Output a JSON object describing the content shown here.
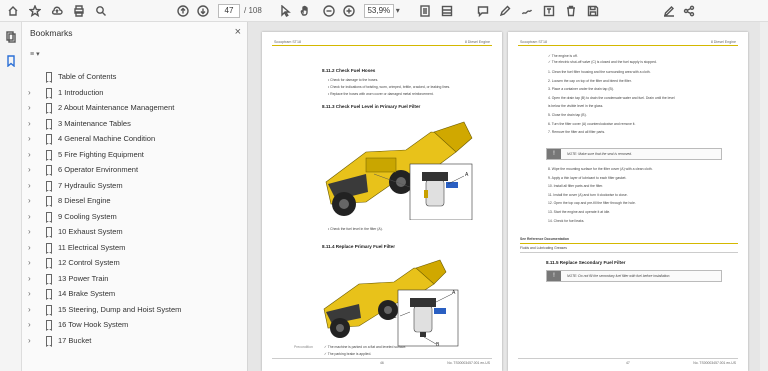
{
  "toolbar": {
    "current_page": "47",
    "page_total": "/ 108",
    "zoom": "53,9%"
  },
  "panel": {
    "title": "Bookmarks",
    "close": "×",
    "options_icon": "≡",
    "options_chevron": "▾"
  },
  "bookmarks": [
    {
      "label": "Table of Contents",
      "expandable": false
    },
    {
      "label": "1 Introduction",
      "expandable": true
    },
    {
      "label": "2 About Maintenance Management",
      "expandable": true
    },
    {
      "label": "3 Maintenance Tables",
      "expandable": true
    },
    {
      "label": "4 General Machine Condition",
      "expandable": true
    },
    {
      "label": "5 Fire Fighting Equipment",
      "expandable": true
    },
    {
      "label": "6 Operator Environment",
      "expandable": true
    },
    {
      "label": "7 Hydraulic System",
      "expandable": true
    },
    {
      "label": "8 Diesel Engine",
      "expandable": true
    },
    {
      "label": "9 Cooling System",
      "expandable": true
    },
    {
      "label": "10 Exhaust System",
      "expandable": true
    },
    {
      "label": "11 Electrical System",
      "expandable": true
    },
    {
      "label": "12 Control System",
      "expandable": true
    },
    {
      "label": "13 Power Train",
      "expandable": true
    },
    {
      "label": "14 Brake System",
      "expandable": true
    },
    {
      "label": "15 Steering, Dump and Hoist System",
      "expandable": true
    },
    {
      "label": "16 Tow Hook System",
      "expandable": true
    },
    {
      "label": "17 Bucket",
      "expandable": true
    }
  ],
  "page_left": {
    "header_left": "Scooptram ST18",
    "header_right": "8 Diesel Engine",
    "h1": "8.11.2 Check Fuel Hoses",
    "bullets1": [
      "Check for damage to the hoses.",
      "Check for indications of twisting, worn, crimped, brittle, cracked, or leaking lines.",
      "Replace the hoses with worn cover or damaged metal reinforcement."
    ],
    "h2": "8.11.3 Check Fuel Level in Primary Fuel Filter",
    "callout_a": "A",
    "caption1": "Check the fuel level in the filter (A).",
    "h3": "8.11.4 Replace Primary Fuel Filter",
    "callout_a2": "A",
    "callout_b2": "B",
    "callout_c2": "C",
    "precond_label": "Precondition",
    "precond1": "The machine is parked on a flat and leveled surface.",
    "precond2": "The parking brake is applied.",
    "footer_left": "46",
    "footer_right": "No. TS00003457.001 en-US"
  },
  "page_right": {
    "header_left": "Scooptram ST18",
    "header_right": "8 Diesel Engine",
    "checks": [
      "The engine is off.",
      "The electric shut-off valve (C) is closed and the fuel supply is stopped."
    ],
    "steps": [
      "1.  Clean the fuel filter housing and the surrounding area with a cloth.",
      "2.  Loosen the cap on top of the filter and bleed the filter.",
      "3.  Place a container under the drain tap (B).",
      "4.  Open the drain tap (B) to drain the condensate water and fuel. Drain until the level",
      "     is below the visible level in the glass.",
      "5.  Close the drain tap (B).",
      "6.  Turn the filter cover (A) counterclockwise and remove it.",
      "7.  Remove the filter and all filter parts."
    ],
    "note1": "NOTE: Make sure that the seal is removed.",
    "steps2": [
      "8.  Wipe the mounting surface for the filter cover (A) with a clean cloth.",
      "9.  Apply a thin layer of lubricant to each filter gasket.",
      "10. Install all filter parts and the filter.",
      "11. Install the cover (A) and turn it clockwise to close.",
      "12. Open the top cap and pre-fill the filter through the hole.",
      "13. Start the engine and operate it at idle.",
      "14. Check for fuel leaks."
    ],
    "see_ref": "See Reference Documentation",
    "ref_item": "Fluids and Lubricating Greases",
    "h1": "8.11.5 Replace Secondary Fuel Filter",
    "note2": "NOTE: Do not fill the secondary fuel filter with fuel before installation.",
    "footer_left": "47",
    "footer_right": "No. TS00003457.001 en-US"
  },
  "colors": {
    "machine_yellow": "#e8c21a",
    "accent_line": "#d4b800"
  }
}
